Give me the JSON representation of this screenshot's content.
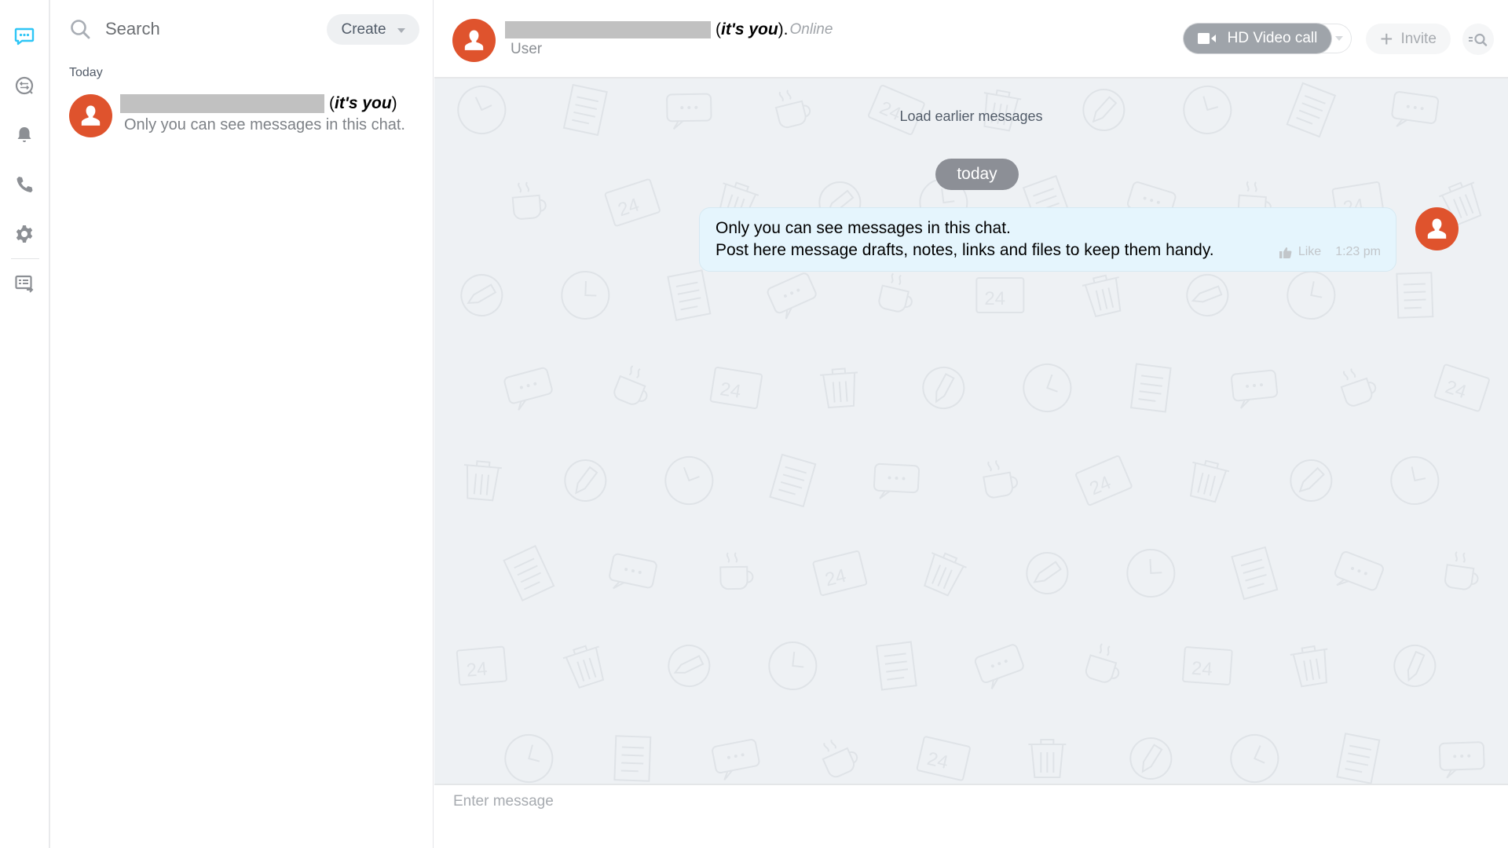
{
  "rail": {
    "items": [
      {
        "id": "chats",
        "icon": "chat-bubble-icon",
        "active": true
      },
      {
        "id": "open-channels",
        "icon": "channels-icon",
        "active": false
      },
      {
        "id": "notifications",
        "icon": "bell-icon",
        "active": false
      },
      {
        "id": "calls",
        "icon": "phone-icon",
        "active": false
      },
      {
        "id": "settings",
        "icon": "gear-icon",
        "active": false
      },
      {
        "id": "tasks",
        "icon": "list-export-icon",
        "active": false
      }
    ],
    "colors": {
      "active": "#2fc6f6",
      "inactive": "#8c8f94"
    }
  },
  "chat_list": {
    "search_placeholder": "Search",
    "create_label": "Create",
    "section_label": "Today",
    "items": [
      {
        "name_redacted": true,
        "name_suffix_open": "(",
        "name_suffix_bold": "it's you",
        "name_suffix_close": ")",
        "preview": "Only you can see messages in this chat."
      }
    ]
  },
  "header": {
    "title_suffix_open": "(",
    "title_suffix_bold": "it's you",
    "title_suffix_close": ").",
    "status": "Online",
    "subtitle": "User",
    "video_call_label": "HD Video call",
    "invite_label": "Invite",
    "invite_icon": "+"
  },
  "feed": {
    "load_earlier_label": "Load earlier messages",
    "date_label": "today",
    "messages": [
      {
        "lines": [
          "Only you can see messages in this chat.",
          "Post here message drafts, notes, links and files to keep them handy."
        ],
        "like_label": "Like",
        "time": "1:23 pm"
      }
    ]
  },
  "composer": {
    "placeholder": "Enter message",
    "value": ""
  },
  "colors": {
    "avatar": "#df532d",
    "message_bubble": "#e5f5fd",
    "feed_background": "#eef1f4",
    "date_pill": "#8c8f96",
    "video_button": "#9fa4aa"
  }
}
